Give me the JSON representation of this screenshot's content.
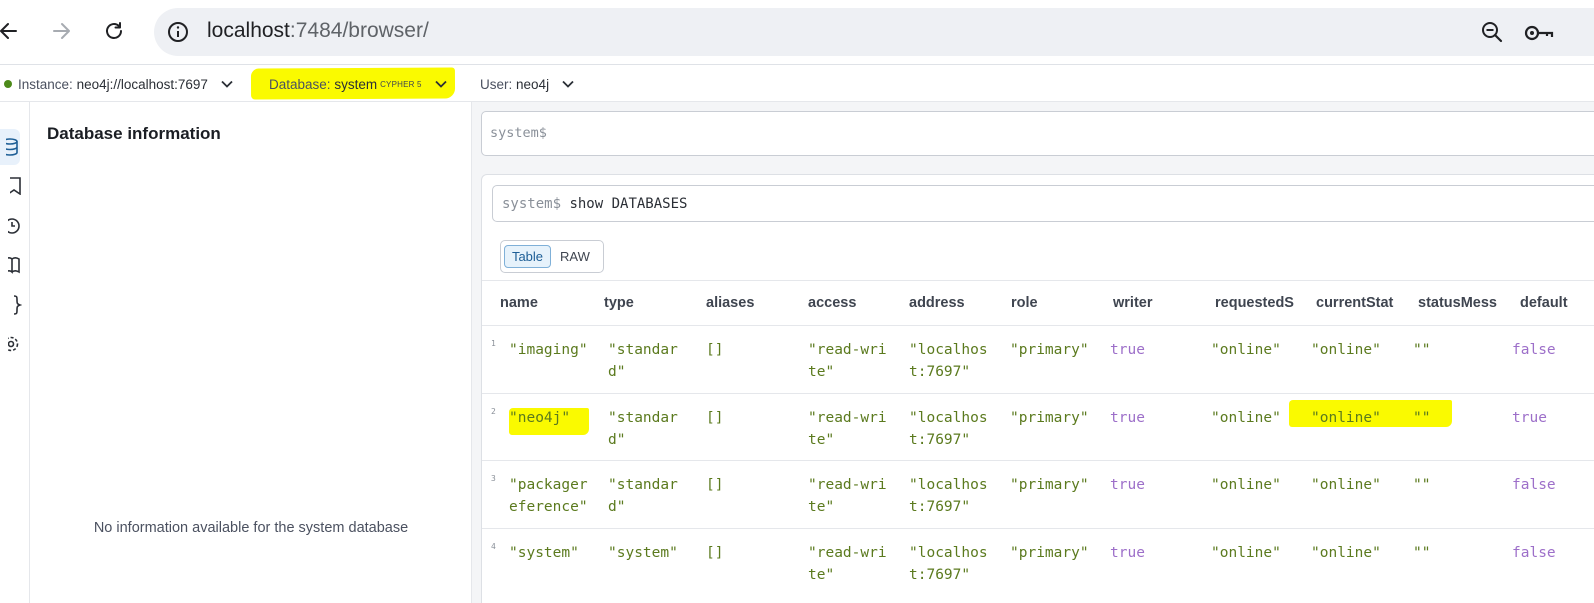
{
  "browser": {
    "url_host": "localhost",
    "url_rest": ":7484/browser/"
  },
  "connection": {
    "instance_label": "Instance:",
    "instance_value": "neo4j://localhost:7697",
    "database_label": "Database:",
    "database_value": "system",
    "cypher_version": "CYPHER 5",
    "user_label": "User:",
    "user_value": "neo4j",
    "status_color": "#4d8a1a",
    "highlight_color": "#fafa00"
  },
  "sidebar": {
    "icons": [
      "database-icon",
      "bookmark-icon",
      "history-icon",
      "book-icon",
      "braces-icon",
      "settings-icon"
    ]
  },
  "info_panel": {
    "title": "Database information",
    "empty_message": "No information available for the system database"
  },
  "editor": {
    "prompt": "system$"
  },
  "result_frame": {
    "prompt": "system$",
    "query": "show DATABASES",
    "view_modes": [
      "Table",
      "RAW"
    ],
    "active_view": "Table"
  },
  "table": {
    "columns": [
      "name",
      "type",
      "aliases",
      "access",
      "address",
      "role",
      "writer",
      "requestedS",
      "currentStat",
      "statusMess",
      "default"
    ],
    "rows": [
      {
        "num": "1",
        "cells": [
          "\"imaging\"",
          "\"standar\nd\"",
          "[]",
          "\"read-wri\nte\"",
          "\"localhos\nt:7697\"",
          "\"primary\"",
          "true",
          "\"online\"",
          "\"online\"",
          "\"\"",
          "false"
        ]
      },
      {
        "num": "2",
        "cells": [
          "\"neo4j\"",
          "\"standar\nd\"",
          "[]",
          "\"read-wri\nte\"",
          "\"localhos\nt:7697\"",
          "\"primary\"",
          "true",
          "\"online\"",
          "\"online\"",
          "\"\"",
          "true"
        ]
      },
      {
        "num": "3",
        "cells": [
          "\"packager\neference\"",
          "\"standar\nd\"",
          "[]",
          "\"read-wri\nte\"",
          "\"localhos\nt:7697\"",
          "\"primary\"",
          "true",
          "\"online\"",
          "\"online\"",
          "\"\"",
          "false"
        ]
      },
      {
        "num": "4",
        "cells": [
          "\"system\"",
          "\"system\"",
          "[]",
          "\"read-wri\nte\"",
          "\"localhos\nt:7697\"",
          "\"primary\"",
          "true",
          "\"online\"",
          "\"online\"",
          "\"\"",
          "false"
        ]
      }
    ]
  }
}
